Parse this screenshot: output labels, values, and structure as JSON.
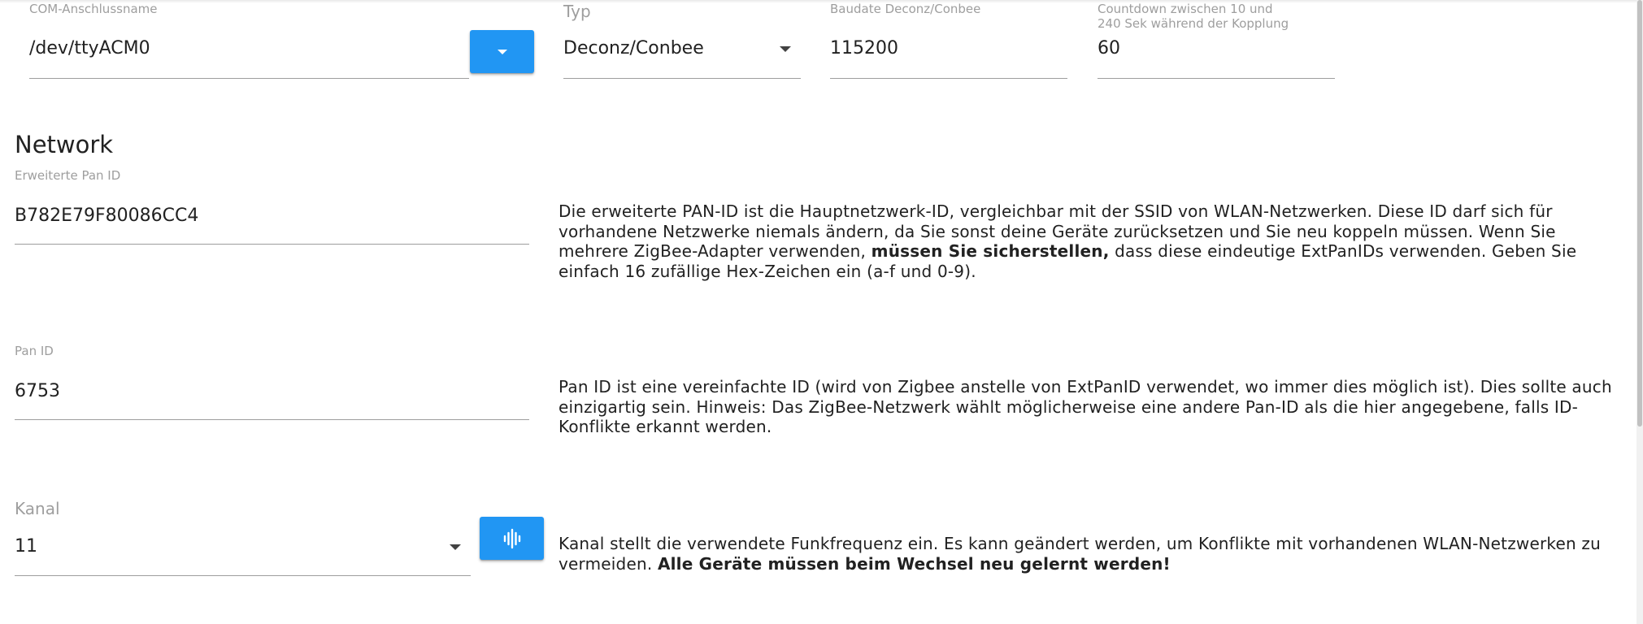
{
  "com_port": {
    "label": "COM-Anschlussname",
    "value": "/dev/ttyACM0",
    "dropdown_icon": "caret-down-icon"
  },
  "typ": {
    "label": "Typ",
    "value": "Deconz/Conbee"
  },
  "baudrate": {
    "label": "Baudate Deconz/Conbee",
    "value": "115200"
  },
  "countdown": {
    "label_line1": "Countdown zwischen 10 und",
    "label_line2": "240 Sek während der Kopplung",
    "value": "60"
  },
  "network": {
    "title": "Network",
    "ext_pan": {
      "label": "Erweiterte Pan ID",
      "value": "B782E79F80086CC4",
      "help_part1": "Die erweiterte PAN-ID ist die Hauptnetzwerk-ID, vergleichbar mit der SSID von WLAN-Netzwerken. Diese ID darf sich für vorhandene Netzwerke niemals ändern, da Sie sonst deine Geräte zurücksetzen und Sie neu koppeln müssen. Wenn Sie mehrere ZigBee-Adapter verwenden, ",
      "help_bold": "müssen Sie sicherstellen,",
      "help_part2": " dass diese eindeutige ExtPanIDs verwenden. Geben Sie einfach 16 zufällige Hex-Zeichen ein (a-f und 0-9)."
    },
    "pan": {
      "label": "Pan ID",
      "value": "6753",
      "help": "Pan ID ist eine vereinfachte ID (wird von Zigbee anstelle von ExtPanID verwendet, wo immer dies möglich ist). Dies sollte auch einzigartig sein. Hinweis: Das ZigBee-Netzwerk wählt möglicherweise eine andere Pan-ID als die hier angegebene, falls ID-Konflikte erkannt werden."
    },
    "channel": {
      "label": "Kanal",
      "value": "11",
      "scan_icon": "waveform-icon",
      "help_part1": "Kanal stellt die verwendete Funkfrequenz ein. Es kann geändert werden, um Konflikte mit vorhandenen WLAN-Netzwerken zu vermeiden. ",
      "help_bold": "Alle Geräte müssen beim Wechsel neu gelernt werden!"
    }
  },
  "colors": {
    "accent": "#2196f3",
    "label": "#9e9e9e",
    "text": "#212121"
  }
}
